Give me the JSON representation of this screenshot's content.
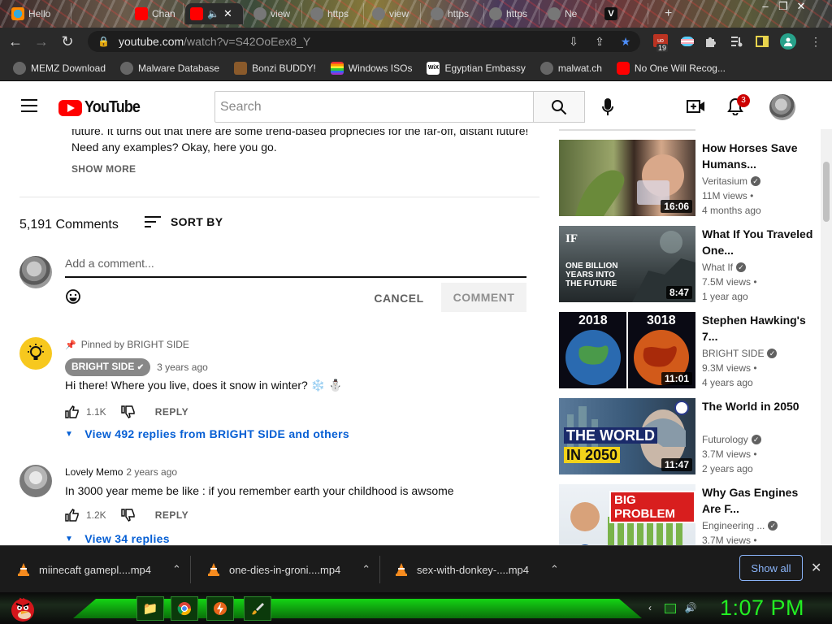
{
  "browser": {
    "tabs": [
      {
        "label": "Hello",
        "icon": "firefox-icon"
      },
      {
        "label": "Chan",
        "icon": "youtube-icon"
      },
      {
        "label": "",
        "icon": "youtube-icon",
        "active": true
      },
      {
        "label": "view",
        "icon": "globe-icon"
      },
      {
        "label": "https",
        "icon": "globe-icon"
      },
      {
        "label": "view",
        "icon": "globe-icon"
      },
      {
        "label": "https",
        "icon": "globe-icon"
      },
      {
        "label": "https",
        "icon": "globe-icon"
      },
      {
        "label": "Ne",
        "icon": "globe-icon"
      },
      {
        "label": "V",
        "icon": "vivaldi-icon"
      }
    ],
    "url_host": "youtube.com",
    "url_path": "/watch?v=S42OoEex8_Y",
    "ext_badge": "19",
    "bookmarks": [
      {
        "label": "MEMZ Download",
        "icon": "globe-icon"
      },
      {
        "label": "Malware Database",
        "icon": "globe-icon"
      },
      {
        "label": "Bonzi BUDDY!",
        "icon": "bonzi-icon"
      },
      {
        "label": "Windows ISOs",
        "icon": "windows-icon"
      },
      {
        "label": "Egyptian Embassy",
        "icon": "wix-icon"
      },
      {
        "label": "malwat.ch",
        "icon": "globe-icon"
      },
      {
        "label": "No One Will Recog...",
        "icon": "youtube-icon"
      }
    ]
  },
  "youtube": {
    "logo_text": "YouTube",
    "search_placeholder": "Search",
    "notification_count": "3"
  },
  "description": {
    "text_line1": "future. It turns out that there are some trend-based prophecies for the far-off, distant future!",
    "text_line2": "Need any examples? Okay, here you go.",
    "show_more": "SHOW MORE"
  },
  "comments_section": {
    "count_label": "5,191 Comments",
    "sort_label": "SORT BY",
    "add_placeholder": "Add a comment...",
    "cancel_label": "CANCEL",
    "comment_label": "COMMENT",
    "comments": [
      {
        "pinned_label": "Pinned by BRIGHT SIDE",
        "author": "BRIGHT SIDE",
        "time": "3 years ago",
        "text": "Hi there! Where you live, does it snow in winter? ❄️ ⛄",
        "likes": "1.1K",
        "reply_label": "REPLY",
        "replies_label": "View 492 replies from BRIGHT SIDE and others"
      },
      {
        "author": "Lovely Memo",
        "time": "2 years ago",
        "text": "In 3000 year meme be like : if you remember earth your childhood is awsome",
        "likes": "1.2K",
        "reply_label": "REPLY",
        "replies_label": "View 34 replies"
      }
    ]
  },
  "recommendations": [
    {
      "title": "How Horses Save Humans...",
      "channel": "Veritasium",
      "views": "11M views",
      "age": "4 months ago",
      "duration": "16:06"
    },
    {
      "title": "What If You Traveled One...",
      "channel": "What If",
      "views": "7.5M views",
      "age": "1 year ago",
      "duration": "8:47",
      "thumb_text": "ONE BILLION YEARS INTO THE FUTURE",
      "thumb_logo": "IF"
    },
    {
      "title": "Stephen Hawking's 7...",
      "channel": "BRIGHT SIDE",
      "views": "9.3M views",
      "age": "4 years ago",
      "duration": "11:01",
      "thumb_left": "2018",
      "thumb_right": "3018"
    },
    {
      "title": "The World in 2050",
      "channel": "Futurology",
      "views": "3.7M views",
      "age": "2 years ago",
      "duration": "11:47",
      "thumb_line1": "THE WORLD",
      "thumb_line2": "IN 2050"
    },
    {
      "title": "Why Gas Engines Are F...",
      "channel": "Engineering ...",
      "views": "3.7M views",
      "age": "",
      "duration": "",
      "thumb_text": "BIG PROBLEM"
    }
  ],
  "downloads": {
    "items": [
      "miinecaft gamepl....mp4",
      "one-dies-in-groni....mp4",
      "sex-with-donkey-....mp4"
    ],
    "show_all": "Show all"
  },
  "taskbar": {
    "clock": "1:07 PM"
  },
  "colors": {
    "youtube_red": "#ff0000",
    "link_blue": "#065fd4",
    "clock_green": "#22ee22",
    "download_accent": "#8ab4f8"
  }
}
